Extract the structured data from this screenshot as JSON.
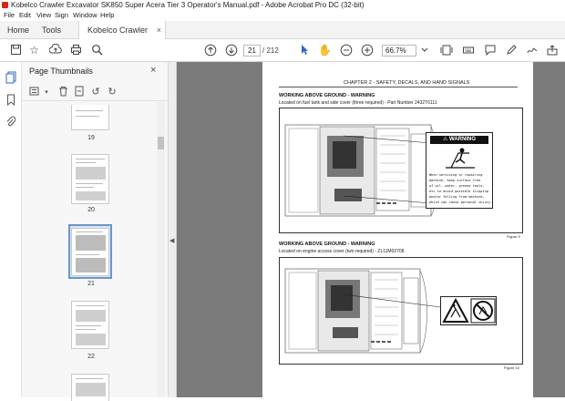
{
  "window": {
    "title": "Kobelco Crawler Excavator SK850 Super Acera Tier 3 Operator's Manual.pdf - Adobe Acrobat Pro DC (32-bit)"
  },
  "menu": [
    "File",
    "Edit",
    "View",
    "Sign",
    "Window",
    "Help"
  ],
  "tabs": {
    "home": "Home",
    "tools": "Tools",
    "document": "Kobelco Crawler Ex...",
    "close": "×"
  },
  "toolbar": {
    "current_page": "21",
    "total_pages": "/ 212",
    "zoom": "66.7%"
  },
  "panel": {
    "title": "Page Thumbnails",
    "close": "×",
    "thumbnails": [
      {
        "label": "19",
        "selected": false
      },
      {
        "label": "20",
        "selected": false
      },
      {
        "label": "21",
        "selected": true
      },
      {
        "label": "22",
        "selected": false
      }
    ]
  },
  "document": {
    "chapter": "CHAPTER 2 - SAFETY, DECALS, AND HAND SIGNALS",
    "section1": {
      "heading": "WORKING ABOVE GROUND - WARNING",
      "subtitle": "Located on fuel tank and side cover (three required) - Part Number 2432T6111",
      "figure": "Figure 9",
      "warning_title": "WARNING",
      "warning_lines": [
        "When servicing or repairing",
        "machine, keep surface free",
        "of oil, water, grease tools,",
        "etc to avoid possible slipping",
        "and/or falling from machine,",
        "which can cause personal injury."
      ]
    },
    "section2": {
      "heading": "WORKING ABOVE GROUND - WARNING",
      "subtitle": "Located on engine access cover (two required) - ZL11M02708",
      "figure": "Figure 10"
    }
  },
  "colors": {
    "accent_selection": "#6a98c8",
    "canvas_bg": "#7b7b7b",
    "brand_red": "#d0281c"
  }
}
